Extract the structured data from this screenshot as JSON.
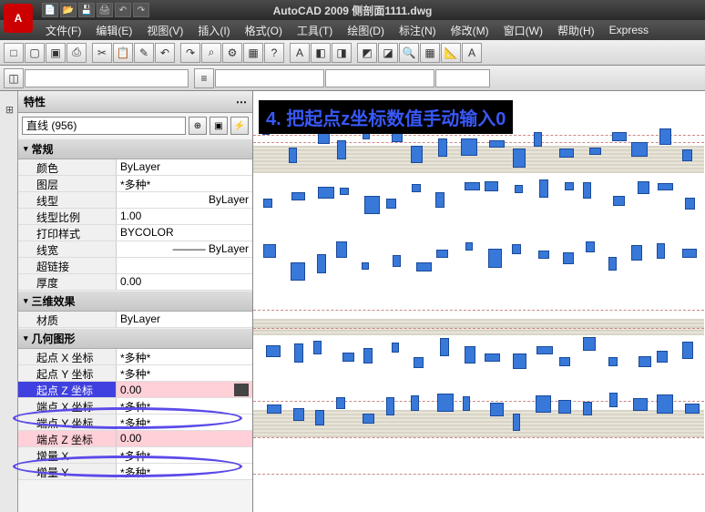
{
  "app": {
    "title": "AutoCAD 2009  侧剖面1111.dwg",
    "logo_letter": "A"
  },
  "qat": [
    "📄",
    "📂",
    "💾",
    "🖨",
    "↶",
    "↷"
  ],
  "menu": [
    {
      "label": "文件(F)"
    },
    {
      "label": "编辑(E)"
    },
    {
      "label": "视图(V)"
    },
    {
      "label": "插入(I)"
    },
    {
      "label": "格式(O)"
    },
    {
      "label": "工具(T)"
    },
    {
      "label": "绘图(D)"
    },
    {
      "label": "标注(N)"
    },
    {
      "label": "修改(M)"
    },
    {
      "label": "窗口(W)"
    },
    {
      "label": "帮助(H)"
    },
    {
      "label": "Express"
    }
  ],
  "toolbar1": [
    "□",
    "▢",
    "▣",
    "⎙",
    "✂",
    "📋",
    "✎",
    "↶",
    "↷",
    "⌕",
    "⚙",
    "▦",
    "?",
    "A",
    "◧",
    "◨",
    "◩",
    "◪",
    "🔍",
    "▦",
    "📐",
    "A"
  ],
  "layer_bar": {
    "layer": "",
    "color": "",
    "combo1": "",
    "combo2": ""
  },
  "toolbar2": [
    "⊞",
    "◫",
    "⊡",
    "◈",
    "◇",
    "△",
    "▽",
    "◁",
    "▷",
    "○",
    "◐",
    "◑",
    "◒",
    "◓",
    "⬡",
    "⬢",
    "✦",
    "✧"
  ],
  "annotation_text": "4. 把起点z坐标数值手动输入0",
  "properties": {
    "title": "特性",
    "selector": "直线 (956)",
    "sections": [
      {
        "name": "常规",
        "rows": [
          {
            "label": "颜色",
            "value": "ByLayer"
          },
          {
            "label": "图层",
            "value": "*多种*"
          },
          {
            "label": "线型",
            "value": "ByLayer",
            "align": "right"
          },
          {
            "label": "线型比例",
            "value": "1.00"
          },
          {
            "label": "打印样式",
            "value": "BYCOLOR"
          },
          {
            "label": "线宽",
            "value": "ByLayer",
            "align": "right",
            "prefix": "——— "
          },
          {
            "label": "超链接",
            "value": ""
          },
          {
            "label": "厚度",
            "value": "0.00"
          }
        ]
      },
      {
        "name": "三维效果",
        "rows": [
          {
            "label": "材质",
            "value": "ByLayer"
          }
        ]
      },
      {
        "name": "几何图形",
        "rows": [
          {
            "label": "起点 X 坐标",
            "value": "*多种*"
          },
          {
            "label": "起点 Y 坐标",
            "value": "*多种*"
          },
          {
            "label": "起点 Z 坐标",
            "value": "0.00",
            "highlight": "blue",
            "editing": true
          },
          {
            "label": "端点 X 坐标",
            "value": "*多种*"
          },
          {
            "label": "端点 Y 坐标",
            "value": "*多种*"
          },
          {
            "label": "端点 Z 坐标",
            "value": "0.00",
            "highlight": "pink"
          },
          {
            "label": "增量 X",
            "value": "*多种*"
          },
          {
            "label": "增量 Y",
            "value": "*多种*"
          }
        ]
      }
    ]
  }
}
